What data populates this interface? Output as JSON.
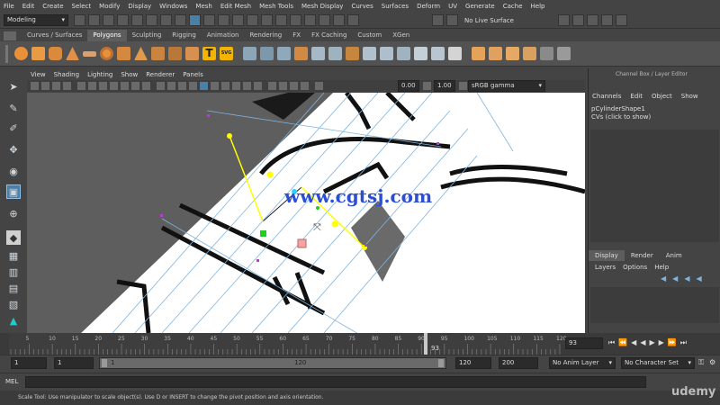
{
  "menubar": [
    "File",
    "Edit",
    "Create",
    "Select",
    "Modify",
    "Display",
    "Windows",
    "Mesh",
    "Edit Mesh",
    "Mesh Tools",
    "Mesh Display",
    "Curves",
    "Surfaces",
    "Deform",
    "UV",
    "Generate",
    "Cache",
    "Help"
  ],
  "statusline": {
    "mode": "Modeling",
    "live_surface": "No Live Surface"
  },
  "shelf_tabs": [
    {
      "label": "Curves / Surfaces",
      "active": false
    },
    {
      "label": "Polygons",
      "active": true
    },
    {
      "label": "Sculpting",
      "active": false
    },
    {
      "label": "Rigging",
      "active": false
    },
    {
      "label": "Animation",
      "active": false
    },
    {
      "label": "Rendering",
      "active": false
    },
    {
      "label": "FX",
      "active": false
    },
    {
      "label": "FX Caching",
      "active": false
    },
    {
      "label": "Custom",
      "active": false
    },
    {
      "label": "XGen",
      "active": false
    }
  ],
  "viewport_menu": [
    "View",
    "Shading",
    "Lighting",
    "Show",
    "Renderer",
    "Panels"
  ],
  "viewport_toolbar": {
    "exposure": "0.00",
    "gamma": "1.00",
    "color_space": "sRGB gamma"
  },
  "watermark": "www.cgtsj.com",
  "channel_box": {
    "title": "Channel Box / Layer Editor",
    "menu": [
      "Channels",
      "Edit",
      "Object",
      "Show"
    ],
    "shape_name": "pCylinderShape1",
    "cvs": "CVs (click to show)",
    "layer_tabs": [
      {
        "label": "Display",
        "active": true
      },
      {
        "label": "Render",
        "active": false
      },
      {
        "label": "Anim",
        "active": false
      }
    ],
    "layer_menu": [
      "Layers",
      "Options",
      "Help"
    ]
  },
  "time_slider": {
    "ticks": [
      "5",
      "10",
      "15",
      "20",
      "25",
      "30",
      "35",
      "40",
      "45",
      "50",
      "55",
      "60",
      "65",
      "70",
      "75",
      "80",
      "85",
      "90",
      "95",
      "100",
      "105",
      "110",
      "115",
      "120"
    ],
    "current_frame": "93",
    "current_frame_field": "93"
  },
  "range_slider": {
    "start": "1",
    "playback_start": "1",
    "range_start_label": "1",
    "range_end_label": "120",
    "playback_end": "120",
    "end": "200",
    "anim_layer": "No Anim Layer",
    "character_set": "No Character Set"
  },
  "mel": {
    "label": "MEL"
  },
  "help_line": "Scale Tool: Use manipulator to scale object(s). Use D or INSERT to change the pivot position and axis orientation.",
  "brand": "udemy",
  "colors": {
    "shelf_active_tab": "#5d5d5d",
    "highlight_blue": "#4a7fa8",
    "manip_yellow": "#ffff00",
    "manip_green": "#22cc22",
    "manip_cyan": "#33ccff",
    "watermark_blue": "#2a4fd6"
  }
}
